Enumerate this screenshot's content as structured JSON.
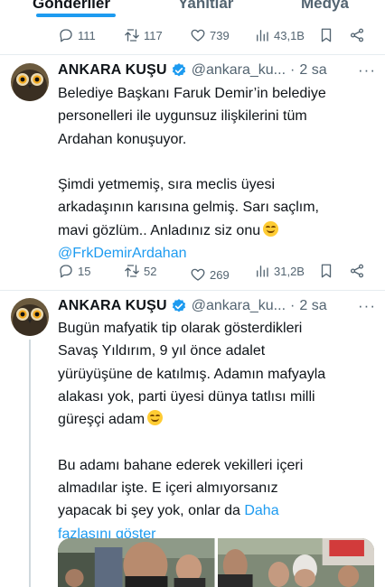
{
  "tabs": [
    "Gönderiler",
    "Yanıtlar",
    "Medya"
  ],
  "tweets": [
    {
      "counts": {
        "replies": "111",
        "retweets": "117",
        "likes": "739",
        "views": "43,1B"
      }
    },
    {
      "author": {
        "name": "ANKARA KUŞU",
        "handle": "@ankara_ku...",
        "time": "2 sa"
      },
      "lines": [
        "Belediye Başkanı Faruk Demir’in belediye",
        "personelleri ile uygunsuz ilişkilerini tüm",
        "Ardahan konuşuyor.",
        "",
        "Şimdi yetmemiş, sıra meclis üyesi",
        "arkadaşının karısına gelmiş. Sarı saçlım,",
        "mavi gözlüm.. Anladınız siz onu"
      ],
      "mention": "@FrkDemirArdahan",
      "counts": {
        "replies": "15",
        "retweets": "52",
        "likes": "269",
        "views": "31,2B"
      }
    },
    {
      "author": {
        "name": "ANKARA KUŞU",
        "handle": "@ankara_ku...",
        "time": "2 sa"
      },
      "lines": [
        "Bugün mafyatik tip olarak gösterdikleri",
        "Savaş Yıldırım, 9 yıl önce adalet",
        "yürüyüşüne de katılmış. Adamın mafyayla",
        "alakası yok, parti üyesi dünya tatlısı milli",
        "güreşçi adam",
        "",
        "Bu adamı bahane ederek vekilleri içeri",
        "almadılar işte. E içeri almıyorsanız",
        "yapacak bi şey yok, onlar da"
      ],
      "inline_link": "Daha",
      "link_line": "fazlasını göster"
    }
  ],
  "icons": {
    "reply": "reply-icon",
    "retweet": "retweet-icon",
    "like": "heart-icon",
    "views": "views-icon",
    "bookmark": "bookmark-icon",
    "share": "share-icon",
    "verified": "verified-badge-icon",
    "more": "more-icon"
  },
  "colors": {
    "accent": "#1d9bf0",
    "muted": "#536471",
    "text": "#0f1419",
    "divider": "#e6ecf0",
    "verified": "#1d9bf0",
    "emoji": "#ffcc33"
  },
  "more_label": "···"
}
